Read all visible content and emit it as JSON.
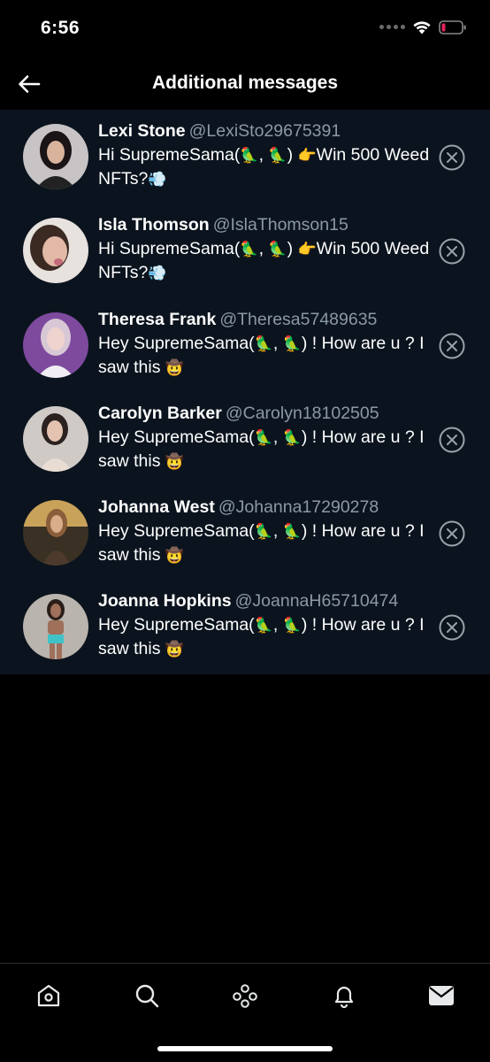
{
  "status": {
    "time": "6:56"
  },
  "header": {
    "title": "Additional messages"
  },
  "messages": [
    {
      "name": "Lexi Stone",
      "handle": "@LexiSto29675391",
      "text_before": "Hi SupremeSama(",
      "text_mid": ", ",
      "text_after": ") ",
      "text_tail": "Win 500 Weed NFTs?",
      "emoji_1": "🦜",
      "emoji_2": "🦜",
      "emoji_3": "👉",
      "emoji_4": "💨"
    },
    {
      "name": "Isla Thomson",
      "handle": "@IslaThomson15",
      "text_before": "Hi SupremeSama(",
      "text_mid": ", ",
      "text_after": ") ",
      "text_tail": "Win 500 Weed NFTs?",
      "emoji_1": "🦜",
      "emoji_2": "🦜",
      "emoji_3": "👉",
      "emoji_4": "💨"
    },
    {
      "name": "Theresa Frank",
      "handle": "@Theresa57489635",
      "text_before": "Hey SupremeSama(",
      "text_mid": ", ",
      "text_after": ") ! How are u ? I saw this ",
      "emoji_1": "🦜",
      "emoji_2": "🦜",
      "emoji_3": "🤠"
    },
    {
      "name": "Carolyn Barker",
      "handle": "@Carolyn18102505",
      "text_before": "Hey SupremeSama(",
      "text_mid": ", ",
      "text_after": ") ! How are u ? I saw this ",
      "emoji_1": "🦜",
      "emoji_2": "🦜",
      "emoji_3": "🤠"
    },
    {
      "name": "Johanna West",
      "handle": "@Johanna17290278",
      "text_before": "Hey SupremeSama(",
      "text_mid": ", ",
      "text_after": ") ! How are u ? I saw this ",
      "emoji_1": "🦜",
      "emoji_2": "🦜",
      "emoji_3": "🤠"
    },
    {
      "name": "Joanna Hopkins",
      "handle": "@JoannaH65710474",
      "text_before": "Hey SupremeSama(",
      "text_mid": ", ",
      "text_after": ") ! How are u ? I saw this ",
      "emoji_1": "🦜",
      "emoji_2": "🦜",
      "emoji_3": "🤠"
    }
  ],
  "tabbar": {
    "items": [
      {
        "icon": "home-icon"
      },
      {
        "icon": "search-icon"
      },
      {
        "icon": "spaces-icon"
      },
      {
        "icon": "notifications-icon"
      },
      {
        "icon": "messages-icon"
      }
    ]
  },
  "colors": {
    "background": "#000000",
    "list_background": "#0b141e",
    "handle": "#8b98a5",
    "battery_low": "#e0245e"
  }
}
